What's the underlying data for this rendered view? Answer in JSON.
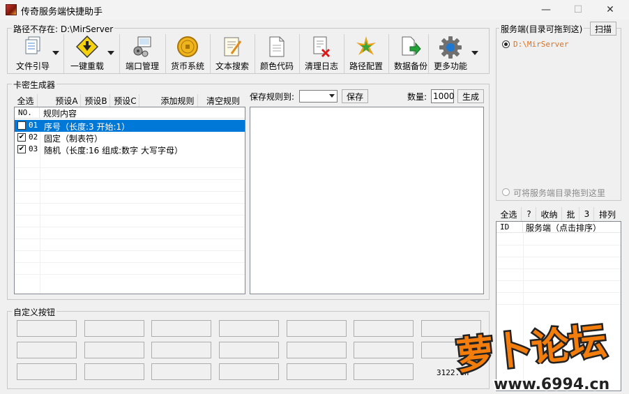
{
  "window": {
    "title": "传奇服务端快捷助手",
    "minimize": "—",
    "maximize": "☐",
    "close": "✕"
  },
  "path_group": {
    "title": "路径不存在: D:\\MirServer"
  },
  "toolbar": [
    {
      "label": "文件引导",
      "icon": "file-guide-icon"
    },
    {
      "label": "一键重载",
      "icon": "reload-icon"
    },
    {
      "label": "端口管理",
      "icon": "port-manage-icon"
    },
    {
      "label": "货币系统",
      "icon": "currency-icon"
    },
    {
      "label": "文本搜索",
      "icon": "text-search-icon"
    },
    {
      "label": "颜色代码",
      "icon": "color-code-icon"
    },
    {
      "label": "清理日志",
      "icon": "clean-log-icon"
    },
    {
      "label": "路径配置",
      "icon": "path-config-icon"
    },
    {
      "label": "数据备份",
      "icon": "data-backup-icon"
    },
    {
      "label": "更多功能",
      "icon": "more-functions-icon"
    }
  ],
  "card_group": {
    "title": "卡密生成器",
    "select_all": "全选",
    "preset_a": "预设A",
    "preset_b": "预设B",
    "preset_c": "预设C",
    "add_rule": "添加规则",
    "clear_rules": "清空规则",
    "col_no": "NO.",
    "col_content": "规则内容",
    "rules": [
      {
        "no": "01",
        "content": "序号（长度:3  开始:1）",
        "checked": true,
        "selected": true
      },
      {
        "no": "02",
        "content": "固定（制表符）",
        "checked": true,
        "selected": false
      },
      {
        "no": "03",
        "content": "随机（长度:16  组成:数字 大写字母）",
        "checked": true,
        "selected": false
      }
    ],
    "save_rule_to": "保存规则到:",
    "save": "保存",
    "quantity_label": "数量:",
    "quantity_value": "1000",
    "generate": "生成"
  },
  "server_group": {
    "title": "服务端(目录可拖到这)",
    "scan": "扫描",
    "server_path": "D:\\MirServer",
    "drag_hint": "可将服务端目录拖到这里",
    "select_all": "全选",
    "question": "?",
    "collapse": "收纳",
    "batch": "批",
    "three": "3",
    "sort": "排列",
    "col_id": "ID",
    "col_server": "服务端（点击排序）"
  },
  "custom_group": {
    "title": "自定义按钮",
    "footer_text": "3122.cn"
  },
  "watermark": {
    "brand": "萝卜论坛",
    "url": "www.6994.cn"
  },
  "colors": {
    "selection": "#0078d7",
    "watermark_orange": "#f27d0c"
  }
}
